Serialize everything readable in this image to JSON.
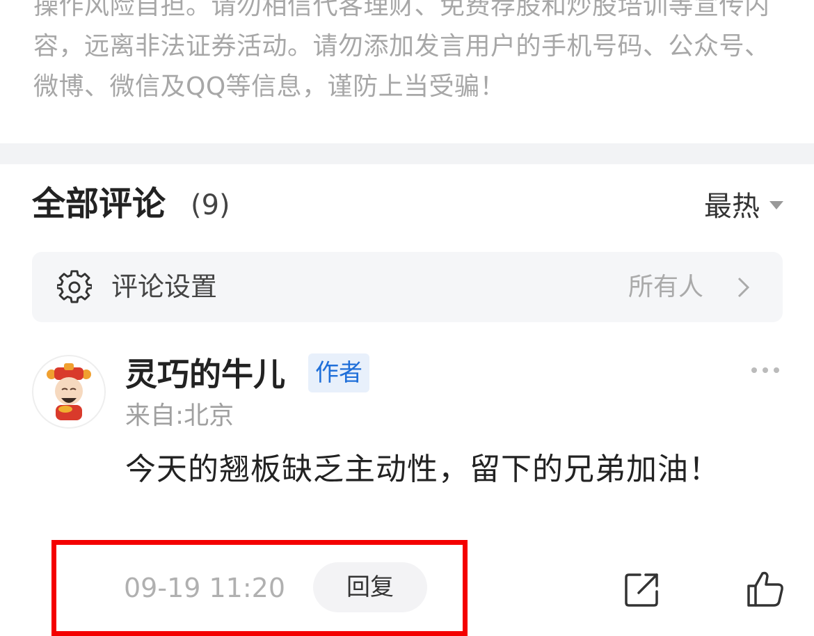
{
  "disclaimer": {
    "text": "操作风险自担。请勿相信代客理财、免费荐股和炒股培训等宣传内容，远离非法证券活动。请勿添加发言用户的手机号码、公众号、微博、微信及QQ等信息，谨防上当受骗！"
  },
  "comments": {
    "title": "全部评论",
    "count": "(9)",
    "sort_label": "最热",
    "sort_icon": "caret-down-icon"
  },
  "settings": {
    "icon": "gear-icon",
    "label": "评论设置",
    "value": "所有人",
    "chevron_icon": "chevron-right-icon"
  },
  "comment": {
    "username": "灵巧的牛儿",
    "badge": "作者",
    "location": "来自:北京",
    "body": "今天的翘板缺乏主动性，留下的兄弟加油！",
    "time": "09-19 11:20",
    "reply_label": "回复",
    "more_icon": "more-dots-icon",
    "share_icon": "share-icon",
    "like_icon": "thumbs-up-icon",
    "avatar_icon": "god-of-wealth-avatar"
  },
  "colors": {
    "accent_blue": "#1f6fd9",
    "highlight_red": "#f40000",
    "muted_text": "#a7a7a7"
  }
}
